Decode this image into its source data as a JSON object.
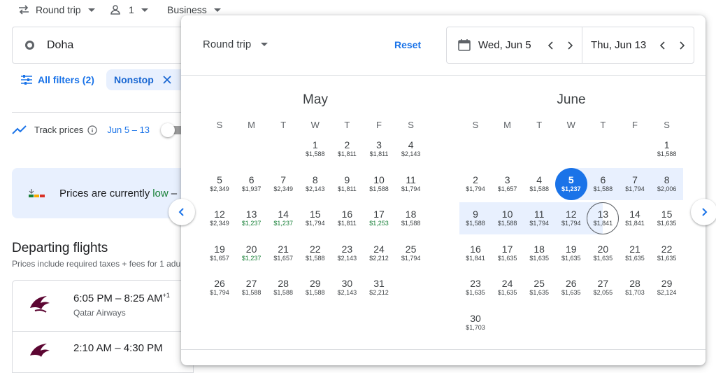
{
  "topbar": {
    "trip_type": "Round trip",
    "passengers": "1",
    "cabin": "Business"
  },
  "search": {
    "origin": "Doha"
  },
  "filters": {
    "all_filters": "All filters (2)",
    "nonstop_chip": "Nonstop"
  },
  "track": {
    "label": "Track prices",
    "dates": "Jun 5 – 13"
  },
  "insight": {
    "prefix": "Prices are currently",
    "level": "low",
    "suffix": "–"
  },
  "departing": {
    "title": "Departing flights",
    "subtitle": "Prices include required taxes + fees for 1 adu",
    "flights": [
      {
        "time": "6:05 PM – 8:25 AM",
        "plus": "+1",
        "airline": "Qatar Airways"
      },
      {
        "time": "2:10 AM – 4:30 PM",
        "plus": "",
        "airline": ""
      }
    ]
  },
  "popup": {
    "trip_type": "Round trip",
    "reset": "Reset",
    "depart_date": "Wed, Jun 5",
    "return_date": "Thu, Jun 13",
    "weekdays": [
      "S",
      "M",
      "T",
      "W",
      "T",
      "F",
      "S"
    ],
    "months": [
      {
        "name": "May",
        "first_weekday": 3,
        "days": [
          {
            "d": "1",
            "p": "$1,588"
          },
          {
            "d": "2",
            "p": "$1,811"
          },
          {
            "d": "3",
            "p": "$1,811"
          },
          {
            "d": "4",
            "p": "$2,143"
          },
          {
            "d": "5",
            "p": "$2,349"
          },
          {
            "d": "6",
            "p": "$1,937"
          },
          {
            "d": "7",
            "p": "$2,349"
          },
          {
            "d": "8",
            "p": "$2,143"
          },
          {
            "d": "9",
            "p": "$1,811"
          },
          {
            "d": "10",
            "p": "$1,588"
          },
          {
            "d": "11",
            "p": "$1,794"
          },
          {
            "d": "12",
            "p": "$2,349"
          },
          {
            "d": "13",
            "p": "$1,237",
            "low": true
          },
          {
            "d": "14",
            "p": "$1,237",
            "low": true
          },
          {
            "d": "15",
            "p": "$1,794"
          },
          {
            "d": "16",
            "p": "$1,811"
          },
          {
            "d": "17",
            "p": "$1,253",
            "low": true
          },
          {
            "d": "18",
            "p": "$1,588"
          },
          {
            "d": "19",
            "p": "$1,657"
          },
          {
            "d": "20",
            "p": "$1,237",
            "low": true
          },
          {
            "d": "21",
            "p": "$1,657"
          },
          {
            "d": "22",
            "p": "$1,588"
          },
          {
            "d": "23",
            "p": "$2,143"
          },
          {
            "d": "24",
            "p": "$2,212"
          },
          {
            "d": "25",
            "p": "$1,794"
          },
          {
            "d": "26",
            "p": "$1,794"
          },
          {
            "d": "27",
            "p": "$1,588"
          },
          {
            "d": "28",
            "p": "$1,588"
          },
          {
            "d": "29",
            "p": "$1,588"
          },
          {
            "d": "30",
            "p": "$2,143"
          },
          {
            "d": "31",
            "p": "$2,212"
          }
        ]
      },
      {
        "name": "June",
        "first_weekday": 6,
        "days": [
          {
            "d": "1",
            "p": "$1,588"
          },
          {
            "d": "2",
            "p": "$1,794"
          },
          {
            "d": "3",
            "p": "$1,657"
          },
          {
            "d": "4",
            "p": "$1,588"
          },
          {
            "d": "5",
            "p": "$1,237",
            "selected": true
          },
          {
            "d": "6",
            "p": "$1,588"
          },
          {
            "d": "7",
            "p": "$1,794"
          },
          {
            "d": "8",
            "p": "$2,006"
          },
          {
            "d": "9",
            "p": "$1,588"
          },
          {
            "d": "10",
            "p": "$1,588"
          },
          {
            "d": "11",
            "p": "$1,794"
          },
          {
            "d": "12",
            "p": "$1,794"
          },
          {
            "d": "13",
            "p": "$1,841",
            "return": true
          },
          {
            "d": "14",
            "p": "$1,841"
          },
          {
            "d": "15",
            "p": "$1,635"
          },
          {
            "d": "16",
            "p": "$1,841"
          },
          {
            "d": "17",
            "p": "$1,635"
          },
          {
            "d": "18",
            "p": "$1,635"
          },
          {
            "d": "19",
            "p": "$1,635"
          },
          {
            "d": "20",
            "p": "$1,635"
          },
          {
            "d": "21",
            "p": "$1,635"
          },
          {
            "d": "22",
            "p": "$1,635"
          },
          {
            "d": "23",
            "p": "$1,635"
          },
          {
            "d": "24",
            "p": "$1,635"
          },
          {
            "d": "25",
            "p": "$1,635"
          },
          {
            "d": "26",
            "p": "$1,635"
          },
          {
            "d": "27",
            "p": "$2,055"
          },
          {
            "d": "28",
            "p": "$1,703"
          },
          {
            "d": "29",
            "p": "$2,124"
          },
          {
            "d": "30",
            "p": "$1,703"
          }
        ]
      }
    ]
  },
  "colors": {
    "accent": "#1a73e8",
    "range": "#e8f0fe",
    "low_price": "#188038"
  }
}
